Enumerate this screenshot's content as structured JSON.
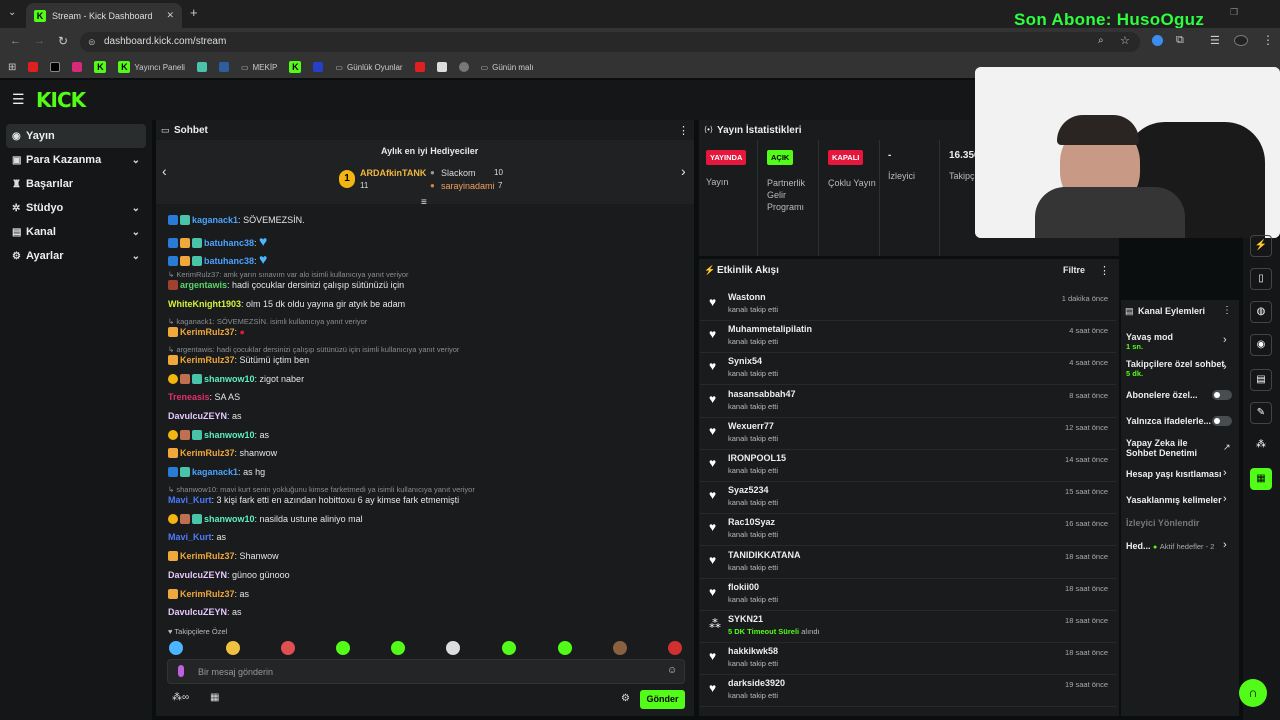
{
  "browser": {
    "tab_title": "Stream - Kick Dashboard",
    "url": "dashboard.kick.com/stream",
    "bookmarks": [
      "Yayıncı Paneli",
      "MEKİP",
      "Günlük Oyunlar",
      "Günün malı"
    ]
  },
  "overlay": {
    "sub_text": "Son Abone: HusoOguz"
  },
  "sidebar": {
    "items": [
      {
        "label": "Yayın",
        "icon": "broadcast-icon"
      },
      {
        "label": "Para Kazanma",
        "icon": "money-icon"
      },
      {
        "label": "Başarılar",
        "icon": "trophy-icon"
      },
      {
        "label": "Stüdyo",
        "icon": "studio-icon"
      },
      {
        "label": "Kanal",
        "icon": "channel-icon"
      },
      {
        "label": "Ayarlar",
        "icon": "gear-icon"
      }
    ]
  },
  "chat": {
    "title": "Sohbet",
    "gifters_title": "Aylık en iyi Hediyeciler",
    "gifters": [
      {
        "rank": "1",
        "name": "ARDAfkinTANK",
        "count": "11"
      },
      {
        "name": "Slackom",
        "count": "10"
      },
      {
        "name": "sarayinadami",
        "count": "7"
      }
    ],
    "messages": [
      {
        "user": "kaganack1",
        "text": "SÖVEMEZSİN.",
        "color": "#4aa3ff"
      },
      {
        "user": "batuhanc38",
        "text": "",
        "color": "#4aa3ff"
      },
      {
        "user": "batuhanc38",
        "text": "",
        "color": "#4aa3ff"
      },
      {
        "reply": "KerimRulz37: amk yarın sınavım var alo isimli kullanıcıya yanıt veriyor"
      },
      {
        "user": "argentawis",
        "text": "hadi çocuklar dersinizi çalışıp sütünüzü için",
        "color": "#5cd66b"
      },
      {
        "user": "WhiteKnight1903",
        "text": "olm 15 dk oldu yayına gir atyık be adam",
        "color": "#d7f23a"
      },
      {
        "reply": "kaganack1: SÖVEMEZSİN. isimli kullanıcıya yanıt veriyor"
      },
      {
        "user": "KerimRulz37",
        "text": "",
        "color": "#f0a73c"
      },
      {
        "reply": "argentawis: hadi çocuklar dersinizi çalışıp sütünüzü için isimli kullanıcıya yanıt veriyor"
      },
      {
        "user": "KerimRulz37",
        "text": "Sütümü içtim ben",
        "color": "#f0a73c"
      },
      {
        "user": "shanwow10",
        "text": "zigot naber",
        "color": "#5cf0c0"
      },
      {
        "user": "Treneasis",
        "text": "SA AS",
        "color": "#e0306a"
      },
      {
        "user": "DavulcuZEYN",
        "text": "as",
        "color": "#e8c8ff"
      },
      {
        "user": "shanwow10",
        "text": "as",
        "color": "#5cf0c0"
      },
      {
        "user": "KerimRulz37",
        "text": "shanwow",
        "color": "#f0a73c"
      },
      {
        "user": "kaganack1",
        "text": "as hg",
        "color": "#4aa3ff"
      },
      {
        "reply": "shanwow10: mavi kurt senin yokluğunu kimse farketmedi ya isimli kullanıcıya yanıt veriyor"
      },
      {
        "user": "Mavi_Kurt",
        "text": "3 kişi fark etti en azından hobittoxu 6 ay kimse fark etmemişti",
        "color": "#4a7bff"
      },
      {
        "user": "shanwow10",
        "text": "nasilda ustune aliniyo mal",
        "color": "#5cf0c0"
      },
      {
        "user": "Mavi_Kurt",
        "text": "as",
        "color": "#4a7bff"
      },
      {
        "user": "KerimRulz37",
        "text": "Shanwow",
        "color": "#f0a73c"
      },
      {
        "user": "DavulcuZEYN",
        "text": "günoo günooo",
        "color": "#e8c8ff"
      },
      {
        "user": "KerimRulz37",
        "text": "as",
        "color": "#f0a73c"
      },
      {
        "user": "DavulcuZEYN",
        "text": "as",
        "color": "#e8c8ff"
      }
    ],
    "emote_section": "Takipçilere Özel",
    "input_placeholder": "Bir mesaj gönderin",
    "send_label": "Gönder"
  },
  "stats": {
    "title": "Yayın İstatistikleri",
    "cols": [
      {
        "pill": "YAYINDA",
        "label": "Yayın",
        "pill_color": "#e5173c"
      },
      {
        "pill": "AÇIK",
        "label": "Partnerlik Gelir Programı",
        "pill_color": "#53fc18"
      },
      {
        "pill": "KAPALI",
        "label": "Çoklu Yayın",
        "pill_color": "#e5173c"
      },
      {
        "value": "-",
        "label": "İzleyici"
      },
      {
        "value": "16.356",
        "label": "Takipçi"
      }
    ]
  },
  "feed": {
    "title": "Etkinlik Akışı",
    "filter_label": "Filtre",
    "items": [
      {
        "name": "Wastonn",
        "desc": "kanalı takip etti",
        "time": "1 dakika önce"
      },
      {
        "name": "Muhammetalipilatin",
        "desc": "kanalı takip etti",
        "time": "4 saat önce"
      },
      {
        "name": "Synix54",
        "desc": "kanalı takip etti",
        "time": "4 saat önce"
      },
      {
        "name": "hasansabbah47",
        "desc": "kanalı takip etti",
        "time": "8 saat önce"
      },
      {
        "name": "Wexuerr77",
        "desc": "kanalı takip etti",
        "time": "12 saat önce"
      },
      {
        "name": "IRONPOOL15",
        "desc": "kanalı takip etti",
        "time": "14 saat önce"
      },
      {
        "name": "Syaz5234",
        "desc": "kanalı takip etti",
        "time": "15 saat önce"
      },
      {
        "name": "Rac10Syaz",
        "desc": "kanalı takip etti",
        "time": "16 saat önce"
      },
      {
        "name": "TANIDIKKATANA",
        "desc": "kanalı takip etti",
        "time": "18 saat önce"
      },
      {
        "name": "flokii00",
        "desc": "kanalı takip etti",
        "time": "18 saat önce"
      },
      {
        "name": "SYKN21",
        "desc_highlight": "5 DK Timeout Süreli",
        "desc": "alındı",
        "time": "18 saat önce"
      },
      {
        "name": "hakkikwk58",
        "desc": "kanalı takip etti",
        "time": "18 saat önce"
      },
      {
        "name": "darkside3920",
        "desc": "kanalı takip etti",
        "time": "19 saat önce"
      }
    ]
  },
  "actions": {
    "title": "Kanal Eylemleri",
    "slow_mode": "Yavaş mod",
    "slow_mode_val": "1 sn.",
    "followers_only": "Takipçilere özel sohbet",
    "followers_only_val": "5 dk.",
    "subs_only": "Abonelere özel...",
    "emotes_only": "Yalnızca ifadelerle...",
    "ai_mod": "Yapay Zeka ile Sohbet Denetimi",
    "account_age": "Hesap yaşı kısıtlaması",
    "banned_words": "Yasaklanmış kelimeler",
    "viewer_redirect": "İzleyici Yönlendir",
    "goals": "Hed...",
    "goals_val": "Aktif hedefler - 2"
  }
}
